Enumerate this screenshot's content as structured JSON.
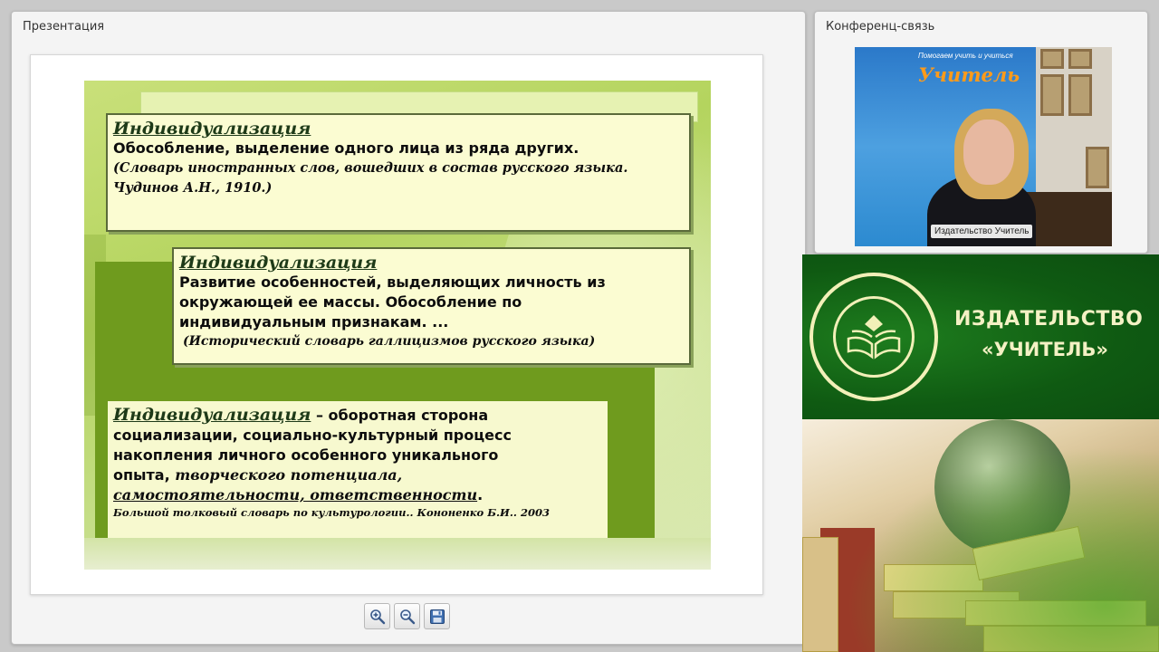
{
  "presentation_panel": {
    "title": "Презентация"
  },
  "conference_panel": {
    "title": "Конференц-связь",
    "participant_name": "Издательство Учитель"
  },
  "video_banner": {
    "subtitle": "Помогаем учить и учиться",
    "title": "Учитель"
  },
  "slide": {
    "box1": {
      "term": "Индивидуализация",
      "definition": "Обособление, выделение одного лица из ряда других.",
      "source_line1": "(Словарь иностранных слов, вошедших в состав русского языка.",
      "source_line2": "Чудинов А.Н., 1910.)"
    },
    "box2": {
      "term": "Индивидуализация",
      "definition_line1": "Развитие особенностей, выделяющих личность из",
      "definition_line2": "окружающей ее массы. Обособление по",
      "definition_line3": "индивидуальным признакам. ...",
      "source": "(Исторический словарь галлицизмов русского языка)"
    },
    "box3": {
      "term": "Индивидуализация",
      "definition_start": " – оборотная сторона",
      "line2": "социализации, социально-культурный процесс",
      "line3": "накопления личного особенного уникального",
      "line4_plain": "опыта, ",
      "line4_italic": "творческого потенциала,",
      "line5_italic": "самостоятельности, ответственности",
      "line5_end": ".",
      "source": "Большой толковый словарь по культурологии.. Кононенко Б.И.. 2003"
    }
  },
  "toolbar": {
    "zoom_in_icon": "magnifier-plus",
    "zoom_out_icon": "magnifier-minus",
    "save_icon": "floppy-disk"
  },
  "promo": {
    "brand_line1": "ИЗДАТЕЛЬСТВО",
    "brand_line2": "«УЧИТЕЛЬ»"
  },
  "colors": {
    "promo_green": "#0f5a12",
    "brand_text": "#f4f1c4",
    "slide_box": "#fbfcd2",
    "slide_green": "#6f9b1e"
  }
}
